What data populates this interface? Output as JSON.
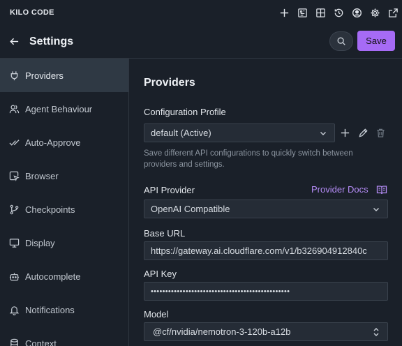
{
  "app": {
    "brand": "KILO CODE"
  },
  "topbar": {
    "icons": [
      "plus-icon",
      "history-grid-icon",
      "extensions-icon",
      "history-icon",
      "account-icon",
      "gear-icon",
      "popout-icon"
    ]
  },
  "header": {
    "title": "Settings",
    "save_label": "Save"
  },
  "sidebar": {
    "items": [
      {
        "label": "Providers",
        "icon": "plug-icon",
        "active": true
      },
      {
        "label": "Agent Behaviour",
        "icon": "users-icon"
      },
      {
        "label": "Auto-Approve",
        "icon": "check-double-icon"
      },
      {
        "label": "Browser",
        "icon": "browser-cursor-icon"
      },
      {
        "label": "Checkpoints",
        "icon": "git-branch-icon"
      },
      {
        "label": "Display",
        "icon": "monitor-icon"
      },
      {
        "label": "Autocomplete",
        "icon": "robot-icon"
      },
      {
        "label": "Notifications",
        "icon": "bell-icon"
      },
      {
        "label": "Context",
        "icon": "database-icon"
      }
    ]
  },
  "main": {
    "section_title": "Providers",
    "config_profile": {
      "label": "Configuration Profile",
      "value": "default (Active)",
      "help": "Save different API configurations to quickly switch between providers and settings."
    },
    "api_provider": {
      "label": "API Provider",
      "value": "OpenAI Compatible",
      "docs_link": "Provider Docs"
    },
    "base_url": {
      "label": "Base URL",
      "value": "https://gateway.ai.cloudflare.com/v1/b326904912840c"
    },
    "api_key": {
      "label": "API Key",
      "value": "••••••••••••••••••••••••••••••••••••••••••••••••"
    },
    "model": {
      "label": "Model",
      "value": "@cf/nvidia/nemotron-3-120b-a12b"
    }
  }
}
